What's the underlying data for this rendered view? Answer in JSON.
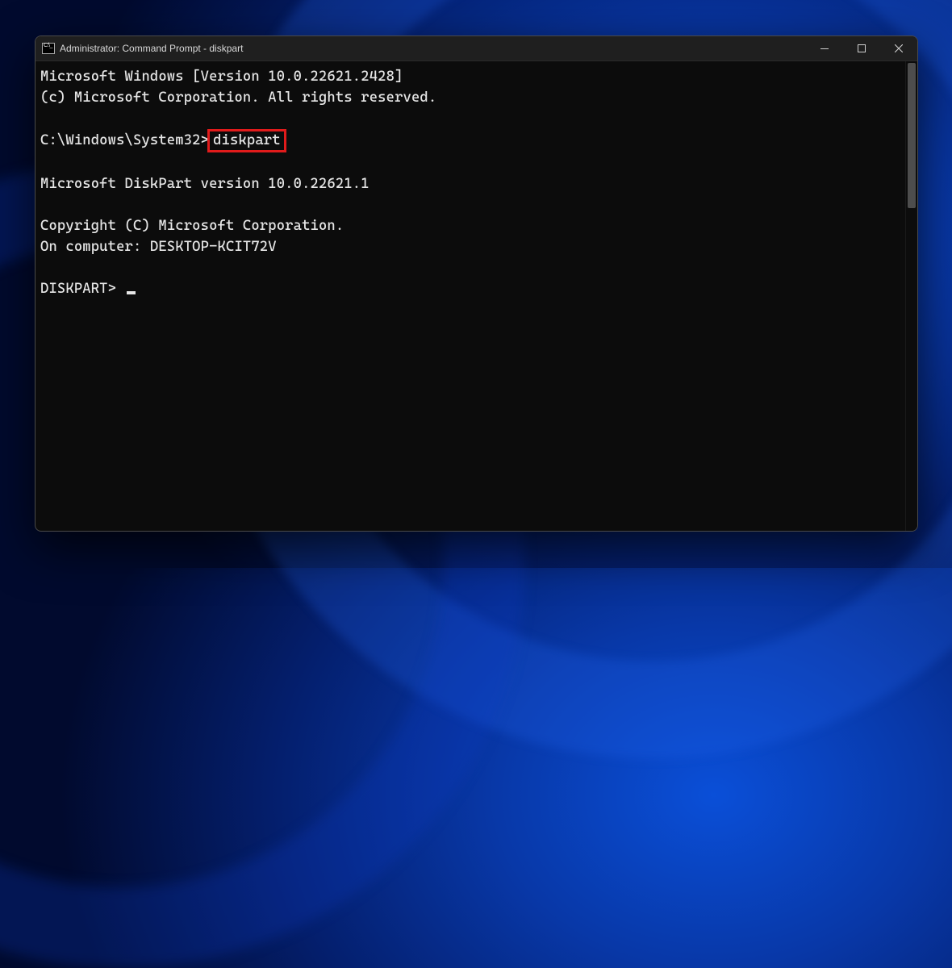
{
  "window": {
    "title": "Administrator: Command Prompt - diskpart"
  },
  "terminal": {
    "line1": "Microsoft Windows [Version 10.0.22621.2428]",
    "line2": "(c) Microsoft Corporation. All rights reserved.",
    "prompt1_path": "C:\\Windows\\System32>",
    "prompt1_cmd": "diskpart",
    "line3": "Microsoft DiskPart version 10.0.22621.1",
    "line4": "Copyright (C) Microsoft Corporation.",
    "line5": "On computer: DESKTOP-KCIT72V",
    "prompt2": "DISKPART> "
  },
  "highlight_color": "#e11b1b"
}
